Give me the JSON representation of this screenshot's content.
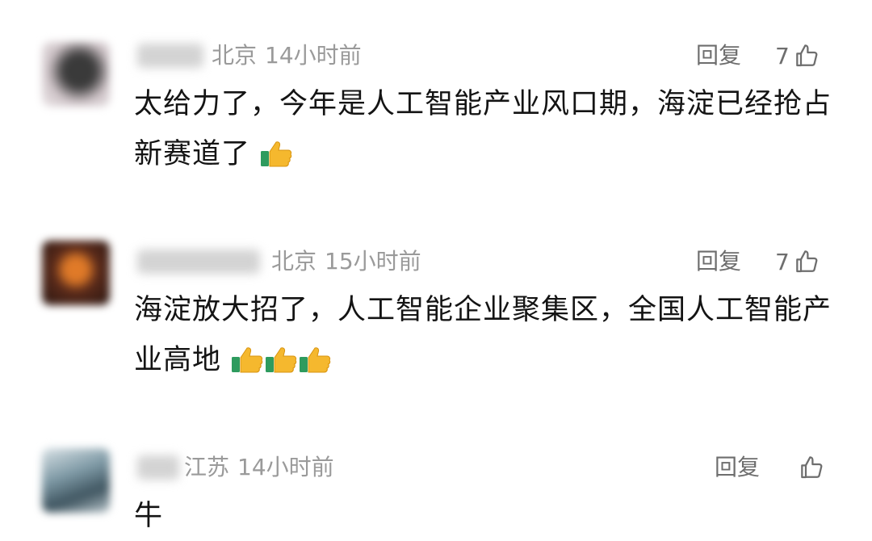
{
  "comments": [
    {
      "location": "北京",
      "time": "14小时前",
      "reply_label": "回复",
      "likes": "7",
      "text": "太给力了，今年是人工智能产业风口期，海淀已经抢占新赛道了",
      "emoji_count": 1,
      "emoji_icon": "thumbs-up-icon"
    },
    {
      "location": "北京",
      "time": "15小时前",
      "reply_label": "回复",
      "likes": "7",
      "text": "海淀放大招了，人工智能企业聚集区，全国人工智能产业高地",
      "emoji_count": 3,
      "emoji_icon": "thumbs-up-icon"
    },
    {
      "location": "江苏",
      "time": "14小时前",
      "reply_label": "回复",
      "likes": "",
      "text": "牛",
      "emoji_count": 0
    }
  ],
  "colors": {
    "meta": "#9a9a9a",
    "action": "#6e6e6e",
    "text": "#141414",
    "thumb_yellow": "#f5b82e",
    "thumb_cuff": "#2e9b5e"
  }
}
